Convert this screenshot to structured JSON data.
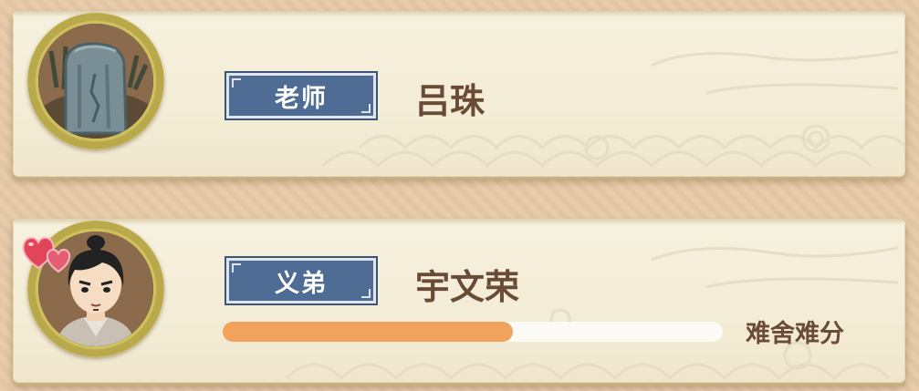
{
  "colors": {
    "background": "#e7c9a6",
    "card": "#f3ecd6",
    "tag_blue": "#4f6d94",
    "name_brown": "#6a4c36",
    "progress_fill": "#f1a35e",
    "progress_track": "#fbfaf4",
    "heart": "#e2455a"
  },
  "entries": [
    {
      "role": "老师",
      "name": "吕珠",
      "avatar_icon": "tombstone-avatar-icon"
    },
    {
      "role": "义弟",
      "name": "宇文荣",
      "avatar_icon": "young-man-avatar-icon",
      "badge_icon": "hearts-icon",
      "affection_fraction": 0.58,
      "relation_text": "难舍难分"
    }
  ]
}
